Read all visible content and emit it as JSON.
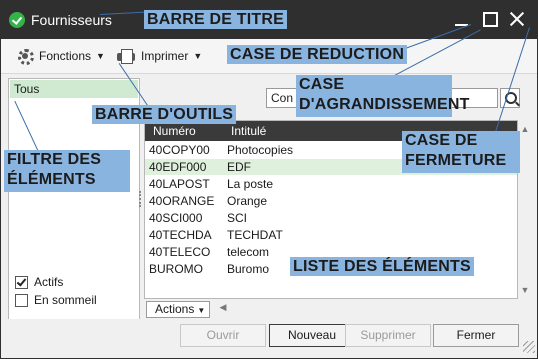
{
  "window": {
    "title": "Fournisseurs"
  },
  "toolbar": {
    "functions_label": "Fonctions",
    "print_label": "Imprimer"
  },
  "filter": {
    "items": [
      "Tous"
    ],
    "checkboxes": [
      {
        "label": "Actifs",
        "checked": true
      },
      {
        "label": "En sommeil",
        "checked": false
      }
    ]
  },
  "search": {
    "value": "Con"
  },
  "list": {
    "columns": [
      "Numéro",
      "Intitulé"
    ],
    "rows": [
      {
        "num": "40COPY00",
        "name": "Photocopies"
      },
      {
        "num": "40EDF000",
        "name": "EDF"
      },
      {
        "num": "40LAPOST",
        "name": "La poste"
      },
      {
        "num": "40ORANGE",
        "name": "Orange"
      },
      {
        "num": "40SCI000",
        "name": "SCI"
      },
      {
        "num": "40TECHDA",
        "name": "TECHDAT"
      },
      {
        "num": "40TELECO",
        "name": "telecom"
      },
      {
        "num": "BUROMO",
        "name": "Buromo"
      }
    ],
    "selected_index": 1,
    "actions_label": "Actions"
  },
  "buttons": {
    "open": "Ouvrir",
    "new": "Nouveau",
    "delete": "Supprimer",
    "close": "Fermer"
  },
  "annotations": {
    "title_bar": "BARRE DE TITRE",
    "reduce": "CASE DE REDUCTION",
    "maximize_line1": "CASE",
    "maximize_line2": "D'AGRANDISSEMENT",
    "toolbar": "BARRE D'OUTILS",
    "close_line1": "CASE DE",
    "close_line2": "FERMETURE",
    "filter_line1": "FILTRE DES",
    "filter_line2": "ÉLÉMENTS",
    "list": "LISTE DES ÉLÉMENTS"
  },
  "colors": {
    "title_bar": "#2f2f2f",
    "app_icon": "#35b24a",
    "selection": "#dff0dc",
    "filter_selection": "#cfead0",
    "annotation_bg": "#8ab4e0"
  },
  "icons": [
    "app-icon",
    "minimize-icon",
    "maximize-icon",
    "close-icon",
    "gear-icon",
    "printer-icon",
    "search-icon",
    "resize-grip-icon"
  ]
}
